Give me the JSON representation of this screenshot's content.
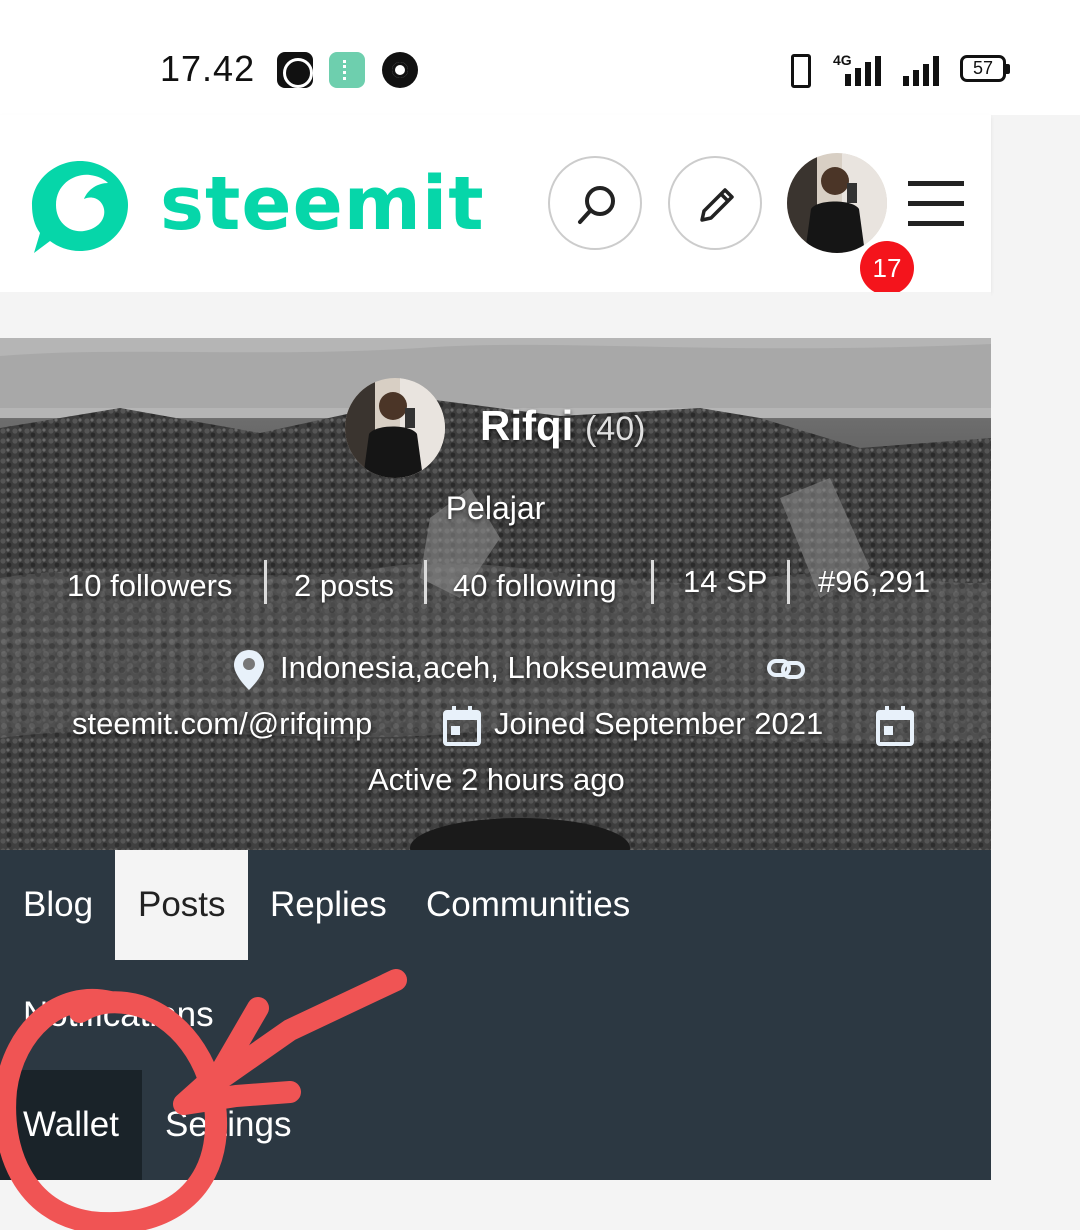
{
  "status_bar": {
    "time": "17.42",
    "network": "4G",
    "battery": "57",
    "icons": [
      "indo-today-app-icon",
      "phone-app-icon",
      "chrome-icon",
      "vibrate-icon",
      "signal-icon",
      "battery-icon"
    ]
  },
  "header": {
    "logo_text": "steemit",
    "notification_count": "17",
    "brand_color": "#06d6a9",
    "badge_color": "#f4141c",
    "icons": [
      "search-icon",
      "pencil-icon",
      "menu-icon"
    ]
  },
  "profile": {
    "name": "Rifqi",
    "reputation": "(40)",
    "bio": "Pelajar",
    "stats": {
      "followers": "10 followers",
      "posts": "2 posts",
      "following": "40 following",
      "sp": "14 SP",
      "rank": "#96,291"
    },
    "location": "Indonesia,aceh, Lhokseumawe",
    "url": "steemit.com/@rifqimp",
    "joined": "Joined September 2021",
    "active": "Active 2 hours ago"
  },
  "tabs": {
    "blog": "Blog",
    "posts": "Posts",
    "replies": "Replies",
    "communities": "Communities",
    "notifications": "Notifications",
    "wallet": "Wallet",
    "settings": "Settings"
  },
  "colors": {
    "nav_background": "#2c3842",
    "annotation": "#f05454"
  }
}
